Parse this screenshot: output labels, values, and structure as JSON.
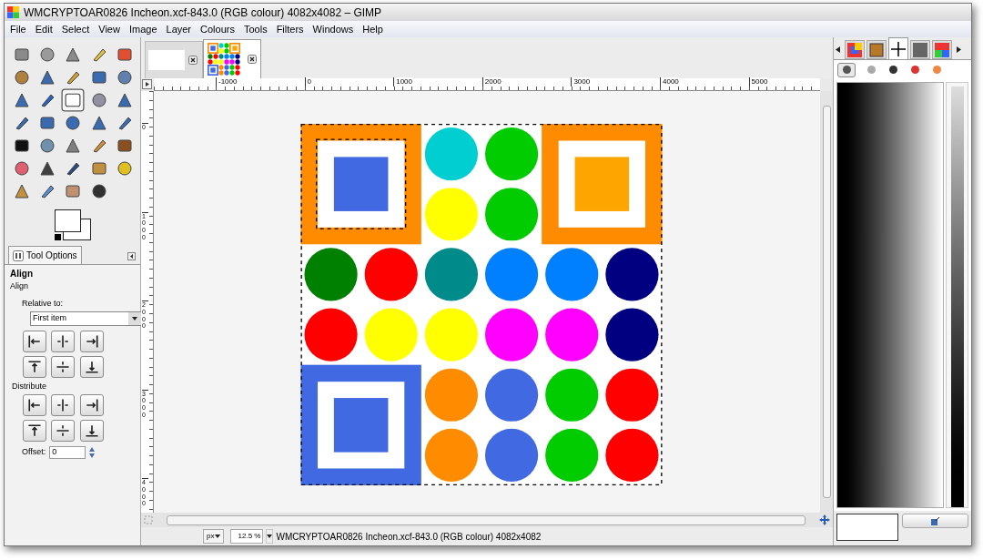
{
  "window": {
    "title": "WMCRYPTOAR0826 Incheon.xcf-843.0 (RGB colour) 4082x4082 – GIMP"
  },
  "menu": [
    "File",
    "Edit",
    "Select",
    "View",
    "Image",
    "Layer",
    "Colours",
    "Tools",
    "Filters",
    "Windows",
    "Help"
  ],
  "toolbox": {
    "tools": [
      {
        "selected": false
      },
      {
        "selected": false
      },
      {
        "selected": false
      },
      {
        "selected": false
      },
      {
        "selected": false
      },
      {
        "selected": false
      },
      {
        "selected": false
      },
      {
        "selected": false
      },
      {
        "selected": false
      },
      {
        "selected": false
      },
      {
        "selected": false
      },
      {
        "selected": false
      },
      {
        "selected": true
      },
      {
        "selected": false
      },
      {
        "selected": false
      },
      {
        "selected": false
      },
      {
        "selected": false
      },
      {
        "selected": false
      },
      {
        "selected": false
      },
      {
        "selected": false
      },
      {
        "selected": false
      },
      {
        "selected": false
      },
      {
        "selected": false
      },
      {
        "selected": false
      },
      {
        "selected": false
      },
      {
        "selected": false
      },
      {
        "selected": false
      },
      {
        "selected": false
      },
      {
        "selected": false
      },
      {
        "selected": false
      },
      {
        "selected": false
      },
      {
        "selected": false
      },
      {
        "selected": false
      },
      {
        "selected": false
      }
    ]
  },
  "tool_options": {
    "tab": "Tool Options",
    "title": "Align",
    "section": "Align",
    "relative_label": "Relative to:",
    "relative_value": "First item",
    "distribute_label": "Distribute",
    "offset_label": "Offset:",
    "offset_value": "0"
  },
  "image_tabs": [
    {
      "selected": false
    },
    {
      "selected": true
    }
  ],
  "ruler": {
    "h_labels": [
      "-1000",
      "0",
      "1000",
      "2000",
      "3000",
      "4000",
      "5000"
    ],
    "v_labels": [
      "0",
      "1000",
      "2000",
      "3000",
      "4000"
    ]
  },
  "status_bar": {
    "unit": "px",
    "zoom": "12.5 %",
    "text": "WMCRYPTOAR0826 Incheon.xcf-843.0 (RGB colour) 4082x4082"
  },
  "dock": {
    "tabs": [
      {
        "selected": false
      },
      {
        "selected": false
      },
      {
        "selected": true
      },
      {
        "selected": false
      },
      {
        "selected": false
      }
    ],
    "panel_tabs": [
      {
        "selected": true
      },
      {
        "selected": false
      },
      {
        "selected": false
      },
      {
        "selected": false
      },
      {
        "selected": false
      }
    ]
  }
}
